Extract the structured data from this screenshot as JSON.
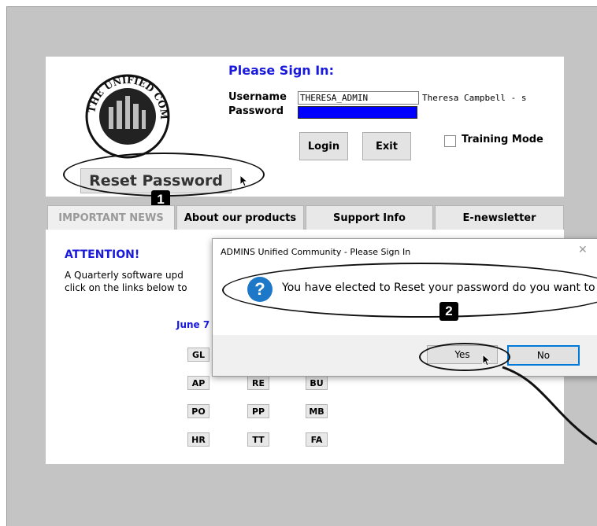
{
  "signin": {
    "title": "Please Sign In:",
    "username_label": "Username",
    "password_label": "Password",
    "username_value": "THERESA_ADMIN",
    "full_name": "Theresa Campbell - s",
    "login_label": "Login",
    "exit_label": "Exit",
    "training_label": "Training Mode",
    "reset_label": "Reset Password",
    "logo_text": "THE UNIFIED COMMUNITY"
  },
  "tabs": [
    {
      "label": "IMPORTANT NEWS"
    },
    {
      "label": "About our products"
    },
    {
      "label": "Support Info"
    },
    {
      "label": "E-newsletter"
    }
  ],
  "news": {
    "heading": "ATTENTION!",
    "line1": "A Quarterly software upd",
    "line2": "click on the links below to",
    "date_prefix": "June 7",
    "modules": [
      "GL",
      "AP",
      "RE",
      "BU",
      "PO",
      "PP",
      "MB",
      "HR",
      "TT",
      "FA"
    ]
  },
  "dialog": {
    "title": "ADMINS Unified Community - Please Sign In",
    "message": "You have elected to Reset your password do you want to c",
    "yes_label": "Yes",
    "no_label": "No"
  },
  "callouts": {
    "step1": "1",
    "step2": "2"
  },
  "colors": {
    "accent_blue": "#1a1adc",
    "password_fill": "#0000ff",
    "dialog_default_border": "#0078d7",
    "question_icon": "#1e78c8"
  }
}
